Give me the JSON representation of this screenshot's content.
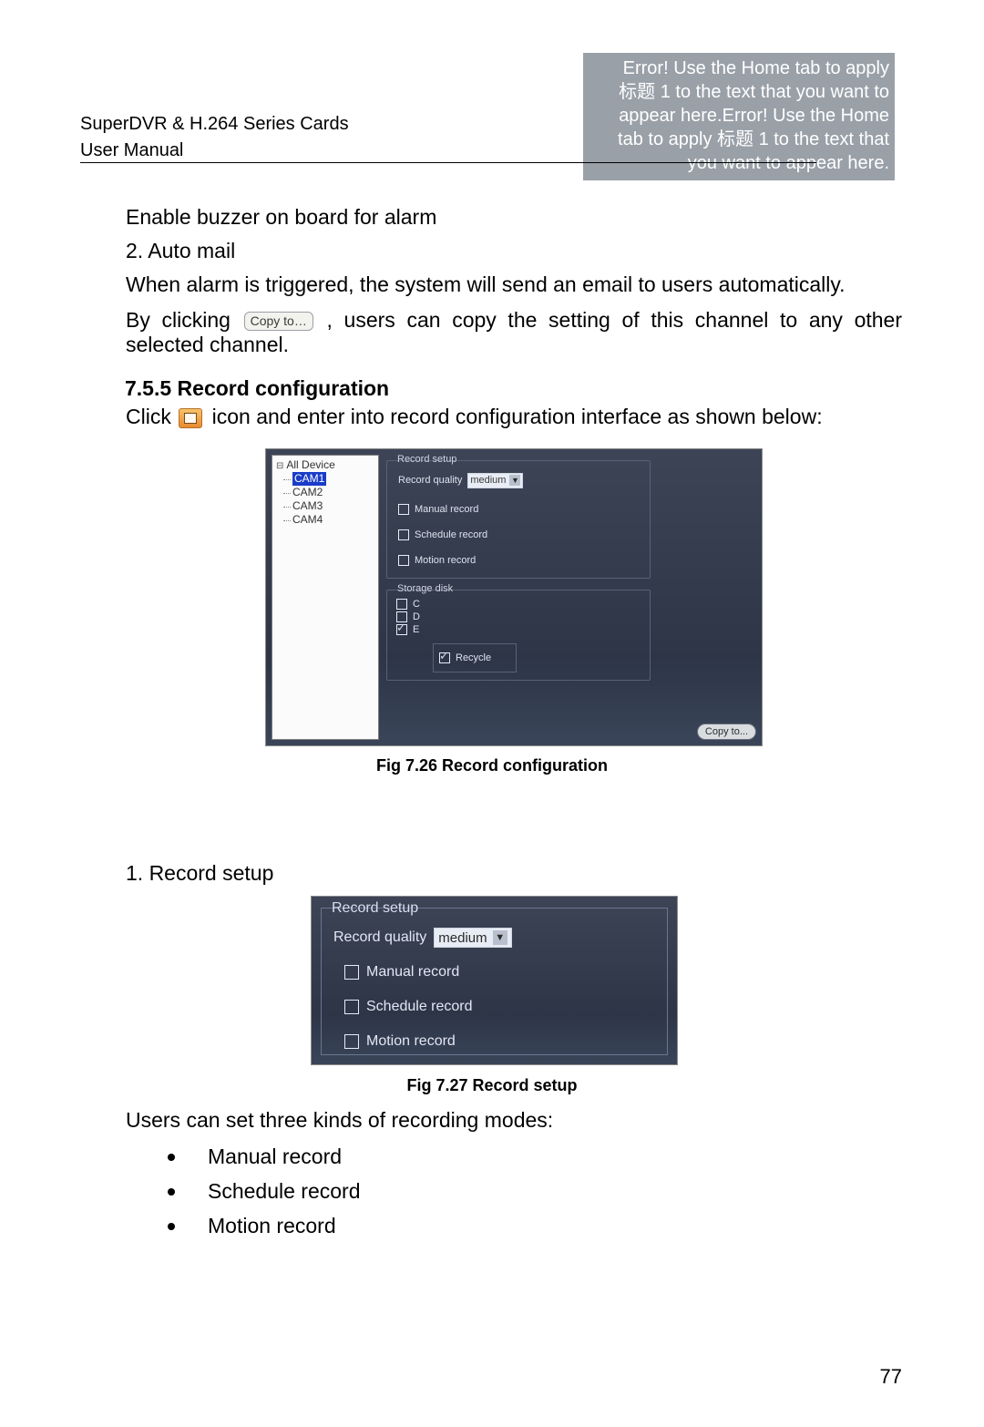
{
  "header": {
    "errbox_lines": [
      "Error! Use the Home tab to apply",
      "标题 1 to the text that you want to",
      "appear here.Error! Use the Home",
      "tab to apply 标题 1 to the text that",
      "you want to appear here."
    ],
    "left1": "SuperDVR & H.264 Series Cards",
    "left2": "User Manual"
  },
  "body": {
    "p1": "Enable buzzer on board for alarm",
    "p2": "2. Auto mail",
    "p3": "When alarm is triggered, the system will send an email to users automatically.",
    "p4_pre": "By  clicking ",
    "copyto_inline": "Copy to…",
    "p4_post": ",  users  can  copy  the  setting  of  this  channel  to  any  other selected channel.",
    "section": "7.5.5  Record configuration",
    "p5_pre": "Click ",
    "p5_post": "  icon and enter into record configuration interface as shown below:",
    "p6": "1. Record setup",
    "p7": "Users can set three kinds of recording modes:",
    "bullets": [
      "Manual record",
      "Schedule record",
      "Motion record"
    ]
  },
  "fig726": {
    "caption": "Fig 7.26 Record configuration",
    "tree": {
      "root": "All Device",
      "cams": [
        "CAM1",
        "CAM2",
        "CAM3",
        "CAM4"
      ],
      "selected": "CAM1"
    },
    "record_setup": {
      "legend": "Record setup",
      "quality_label": "Record quality",
      "quality_value": "medium",
      "manual": "Manual record",
      "schedule": "Schedule record",
      "motion": "Motion record"
    },
    "storage": {
      "legend": "Storage disk",
      "disks": [
        {
          "label": "C",
          "checked": false
        },
        {
          "label": "D",
          "checked": false
        },
        {
          "label": "E",
          "checked": true
        }
      ],
      "recycle": "Recycle"
    },
    "copyto": "Copy to..."
  },
  "fig727": {
    "caption": "Fig 7.27 Record setup",
    "legend": "Record setup",
    "quality_label": "Record quality",
    "quality_value": "medium",
    "manual": "Manual record",
    "schedule": "Schedule record",
    "motion": "Motion record"
  },
  "page_number": "77"
}
